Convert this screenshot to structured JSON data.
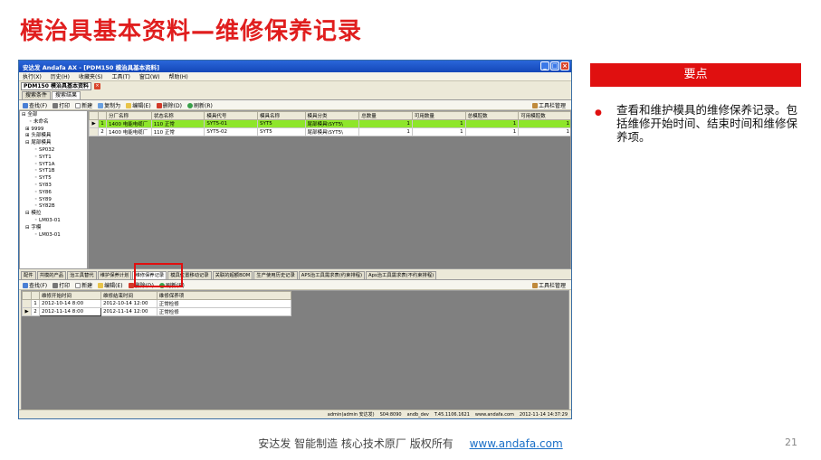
{
  "slide": {
    "title": "模治具基本资料—维修保养记录",
    "side_header": "要点",
    "bullet_text": "查看和维护模具的维修保养记录。包括维修开始时间、结束时间和维修保养项。",
    "footer": "安达发   智能制造 核心技术原厂   版权所有",
    "footer_link": "www.andafa.com",
    "page_number": "21",
    "accent_color": "#e01010"
  },
  "app": {
    "window_title": "安达发 Andafa AX - [PDM150 模治具基本资料]",
    "menu": [
      "执行(X)",
      "历史(H)",
      "收藏夹(S)",
      "工具(T)",
      "窗口(W)",
      "帮助(H)"
    ],
    "doc_tab": "PDM150 模治具基本资料",
    "sub_tabs": [
      "搜索条件",
      "搜索结果"
    ],
    "toolbar": [
      "查找(F)",
      "打印",
      "新建",
      "复制为",
      "编辑(E)",
      "删除(D)",
      "刷新(R)"
    ],
    "toolbar_right": "工具栏管理",
    "tree": [
      "全部",
      "未命名",
      "9999",
      "头部模具",
      "尾部模具",
      "SP032",
      "SYT1",
      "SYT1A",
      "SYT1B",
      "SYT5",
      "SY83",
      "SY86",
      "SY89",
      "SY82B",
      "模拉",
      "LM03-01",
      "字模",
      "LM03-01"
    ],
    "grid": {
      "columns": [
        "分厂名称",
        "状态名称",
        "模具代号",
        "模具名称",
        "模具分类",
        "总数量",
        "可用数量",
        "总模腔数",
        "可用模腔数"
      ],
      "rows": [
        {
          "no": "1",
          "cells": [
            "1400 电能电缆厂",
            "110 正常",
            "SYT5-01",
            "SYT5",
            "尾部模具\\SYT5\\",
            "1",
            "1",
            "1",
            "1"
          ]
        },
        {
          "no": "2",
          "cells": [
            "1400 电能电缆厂",
            "110 正常",
            "SYT5-02",
            "SYT5",
            "尾部模具\\SYT5\\",
            "1",
            "1",
            "1",
            "1"
          ]
        }
      ]
    },
    "bottom_tabs": [
      "配件",
      "共模的产品",
      "治工具替代",
      "维护保养计划",
      "维修保养记录",
      "模具位置移动记录",
      "关联的超额BOM",
      "生产使用历史记录",
      "APS治工具需求表(约束排程)",
      "Aps治工具需求表(不约束排程)"
    ],
    "bottom_toolbar": [
      "查找(F)",
      "打印",
      "新建",
      "编辑(E)",
      "删除(D)",
      "刷新(R)"
    ],
    "maint_grid": {
      "columns": [
        "维修开始时间",
        "维修结束时间",
        "维修保养项"
      ],
      "rows": [
        {
          "no": "1",
          "cells": [
            "2012-10-14 8:00",
            "2012-10-14 12:00",
            "正常检修"
          ]
        },
        {
          "no": "2",
          "cells": [
            "2012-11-14 8:00",
            "2012-11-14 12:00",
            "正常检修"
          ]
        }
      ]
    },
    "status": [
      "admin(admin 安达发)",
      "S04:8090",
      "andb_dev",
      "T.45.1106.1621",
      "www.andafa.com",
      "2012-11-14 14:37:29"
    ]
  }
}
